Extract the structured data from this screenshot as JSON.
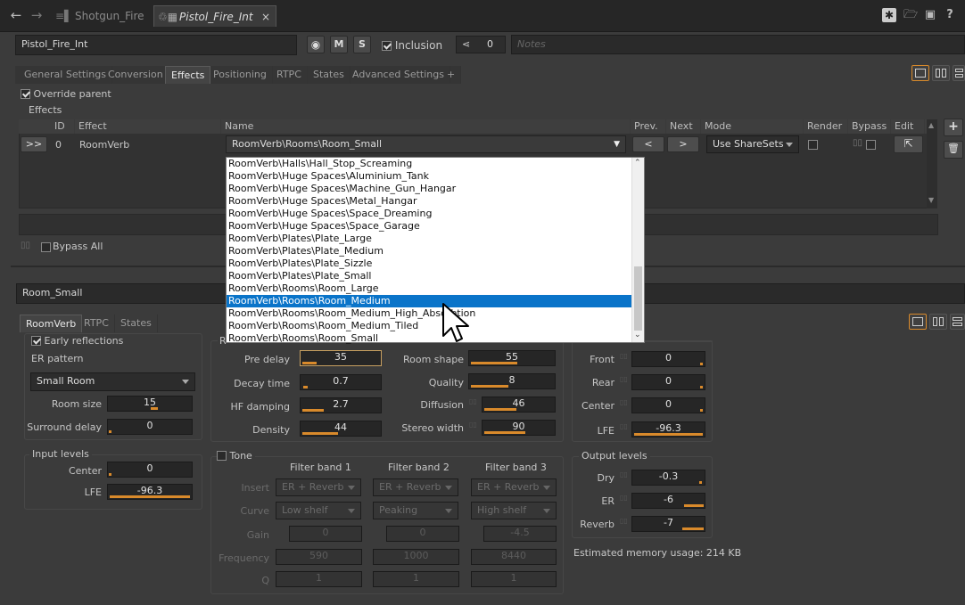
{
  "topbar": {
    "tab1_label": "Shotgun_Fire",
    "tab2_label": "Pistol_Fire_Int",
    "close_glyph": "×"
  },
  "header": {
    "object_name": "Pistol_Fire_Int",
    "m_label": "M",
    "s_label": "S",
    "inclusion_label": "Inclusion",
    "share_count": "0",
    "notes_placeholder": "Notes"
  },
  "property_tabs": [
    "General Settings",
    "Conversion",
    "Effects",
    "Positioning",
    "RTPC",
    "States",
    "Advanced Settings",
    "+"
  ],
  "effects": {
    "override_parent": "Override parent",
    "group_label": "Effects",
    "columns": {
      "id": "ID",
      "effect": "Effect",
      "name": "Name",
      "prev": "Prev.",
      "next": "Next",
      "mode": "Mode",
      "render": "Render",
      "bypass": "Bypass",
      "edit": "Edit"
    },
    "row": {
      "expand": ">>",
      "id": "0",
      "effect": "RoomVerb",
      "name": "RoomVerb\\Rooms\\Room_Small",
      "prev": "<",
      "next": ">",
      "mode": "Use ShareSets"
    },
    "bypass_all": "Bypass All",
    "add": "+",
    "delete_icon": "trash-icon"
  },
  "dropdown": {
    "items": [
      "RoomVerb\\Halls\\Hall_Stop_Screaming",
      "RoomVerb\\Huge Spaces\\Aluminium_Tank",
      "RoomVerb\\Huge Spaces\\Machine_Gun_Hangar",
      "RoomVerb\\Huge Spaces\\Metal_Hangar",
      "RoomVerb\\Huge Spaces\\Space_Dreaming",
      "RoomVerb\\Huge Spaces\\Space_Garage",
      "RoomVerb\\Plates\\Plate_Large",
      "RoomVerb\\Plates\\Plate_Medium",
      "RoomVerb\\Plates\\Plate_Sizzle",
      "RoomVerb\\Plates\\Plate_Small",
      "RoomVerb\\Rooms\\Room_Large",
      "RoomVerb\\Rooms\\Room_Medium",
      "RoomVerb\\Rooms\\Room_Medium_High_Absorbtion",
      "RoomVerb\\Rooms\\Room_Medium_Tiled",
      "RoomVerb\\Rooms\\Room_Small"
    ],
    "selected_index": 11,
    "selection_color": "#0a74c9"
  },
  "shareset": {
    "name": "Room_Small",
    "tabs": [
      "RoomVerb",
      "RTPC",
      "States"
    ]
  },
  "er": {
    "early_reflections": "Early reflections",
    "er_pattern_label": "ER pattern",
    "er_pattern_value": "Small Room",
    "room_size_label": "Room size",
    "room_size": "15",
    "surround_delay_label": "Surround delay",
    "surround_delay": "0"
  },
  "input_levels": {
    "title": "Input levels",
    "center_label": "Center",
    "center": "0",
    "lfe_label": "LFE",
    "lfe": "-96.3"
  },
  "reverb": {
    "group_letter": "R",
    "pre_delay_label": "Pre delay",
    "pre_delay": "35",
    "decay_time_label": "Decay time",
    "decay_time": "0.7",
    "hf_damping_label": "HF damping",
    "hf_damping": "2.7",
    "density_label": "Density",
    "density": "44",
    "room_shape_label": "Room shape",
    "room_shape": "55",
    "quality_label": "Quality",
    "quality": "8",
    "diffusion_label": "Diffusion",
    "diffusion": "46",
    "stereo_width_label": "Stereo width",
    "stereo_width": "90"
  },
  "tone": {
    "title": "Tone",
    "bands": [
      "Filter band 1",
      "Filter band 2",
      "Filter band 3"
    ],
    "insert_label": "Insert",
    "inserts": [
      "ER + Reverb",
      "ER + Reverb",
      "ER + Reverb"
    ],
    "curve_label": "Curve",
    "curves": [
      "Low shelf",
      "Peaking",
      "High shelf"
    ],
    "gain_label": "Gain",
    "gains": [
      "0",
      "0",
      "-4.5"
    ],
    "frequency_label": "Frequency",
    "frequencies": [
      "590",
      "1000",
      "8440"
    ],
    "q_label": "Q",
    "qs": [
      "1",
      "1",
      "1"
    ]
  },
  "output_mix": {
    "front_label": "Front",
    "front": "0",
    "rear_label": "Rear",
    "rear": "0",
    "center_label": "Center",
    "center": "0",
    "lfe_label": "LFE",
    "lfe": "-96.3"
  },
  "output_levels": {
    "title": "Output levels",
    "dry_label": "Dry",
    "dry": "-0.3",
    "er_label": "ER",
    "er": "-6",
    "reverb_label": "Reverb",
    "reverb": "-7",
    "memory": "Estimated memory usage: 214 KB"
  },
  "colors": {
    "accent": "#d98a2b",
    "selection": "#0a74c9"
  }
}
